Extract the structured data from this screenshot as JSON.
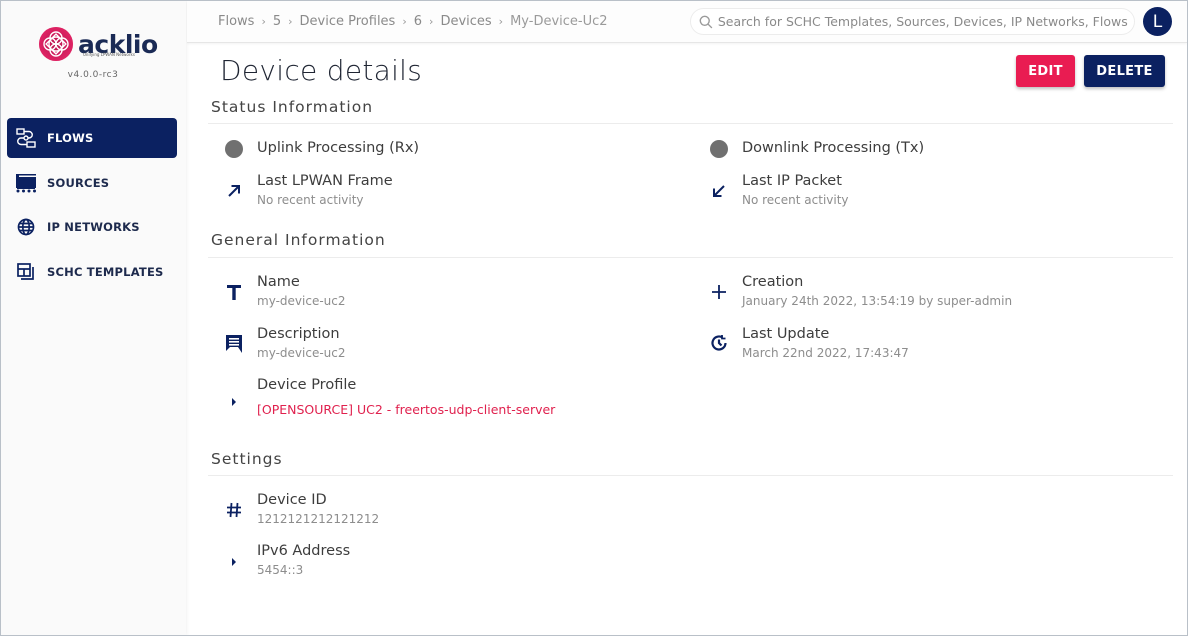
{
  "app": {
    "brand": "acklio",
    "tagline": "Unifying LPWAN Networks",
    "version": "v4.0.0-rc3",
    "brand_color": "#0b2161",
    "accent_color": "#e91c52"
  },
  "sidebar": {
    "items": [
      {
        "label": "FLOWS",
        "icon": "flows-icon",
        "active": true
      },
      {
        "label": "SOURCES",
        "icon": "sources-icon",
        "active": false
      },
      {
        "label": "IP NETWORKS",
        "icon": "globe-icon",
        "active": false
      },
      {
        "label": "SCHC TEMPLATES",
        "icon": "templates-icon",
        "active": false
      }
    ]
  },
  "topbar": {
    "breadcrumb": [
      "Flows",
      "5",
      "Device Profiles",
      "6",
      "Devices",
      "My-Device-Uc2"
    ],
    "search_placeholder": "Search for SCHC Templates, Sources, Devices, IP Networks, Flows",
    "search_value": "",
    "avatar_initial": "L"
  },
  "page": {
    "title": "Device details",
    "edit_label": "EDIT",
    "delete_label": "DELETE"
  },
  "status": {
    "title": "Status Information",
    "uplink": {
      "label": "Uplink Processing (Rx)",
      "icon": "status-dot-icon"
    },
    "downlink": {
      "label": "Downlink Processing (Tx)",
      "icon": "status-dot-icon"
    },
    "last_lpwan": {
      "label": "Last LPWAN Frame",
      "value": "No recent activity",
      "icon": "arrow-up-right-icon"
    },
    "last_ip": {
      "label": "Last IP Packet",
      "value": "No recent activity",
      "icon": "arrow-down-left-icon"
    }
  },
  "general": {
    "title": "General Information",
    "name": {
      "label": "Name",
      "value": "my-device-uc2"
    },
    "description": {
      "label": "Description",
      "value": "my-device-uc2"
    },
    "device_profile": {
      "label": "Device Profile",
      "value": "[OPENSOURCE] UC2 - freertos-udp-client-server"
    },
    "creation": {
      "label": "Creation",
      "value": "January 24th 2022, 13:54:19 by super-admin"
    },
    "last_update": {
      "label": "Last Update",
      "value": "March 22nd 2022, 17:43:47"
    }
  },
  "settings": {
    "title": "Settings",
    "device_id": {
      "label": "Device ID",
      "value": "1212121212121212"
    },
    "ipv6": {
      "label": "IPv6 Address",
      "value": "5454::3"
    }
  }
}
